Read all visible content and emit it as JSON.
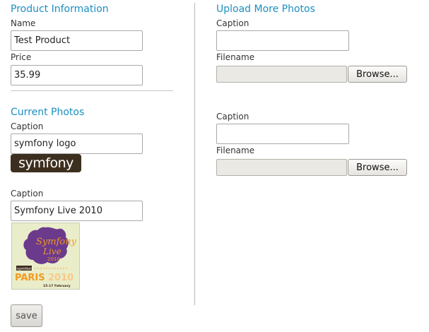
{
  "product_info": {
    "heading": "Product Information",
    "name_label": "Name",
    "name_value": "Test Product",
    "price_label": "Price",
    "price_value": "35.99"
  },
  "current_photos": {
    "heading": "Current Photos",
    "photos": [
      {
        "caption_label": "Caption",
        "caption_value": "symfony logo",
        "image_text": "symfony",
        "image_icon": "symfony-logo-image"
      },
      {
        "caption_label": "Caption",
        "caption_value": "Symfony Live 2010",
        "image_texts": [
          "symfony",
          "PARIS",
          "2010",
          "15-17 February"
        ],
        "image_icon": "symfony-live-2010-image"
      }
    ]
  },
  "upload": {
    "heading": "Upload More Photos",
    "rows": [
      {
        "caption_label": "Caption",
        "caption_value": "",
        "filename_label": "Filename",
        "browse_label": "Browse..."
      },
      {
        "caption_label": "Caption",
        "caption_value": "",
        "filename_label": "Filename",
        "browse_label": "Browse..."
      }
    ]
  },
  "save_label": "save",
  "colors": {
    "heading": "#1c8fc0",
    "logo_bg": "#3d2f1f",
    "live_orange": "#f39a1f",
    "live_purple": "#6b3a8c"
  }
}
